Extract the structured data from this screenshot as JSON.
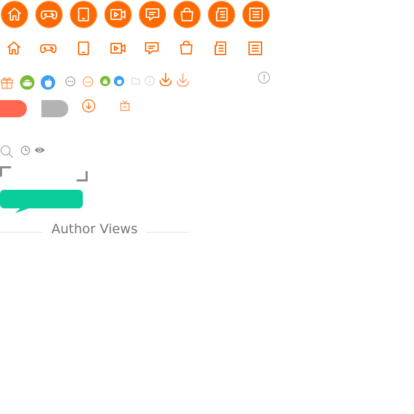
{
  "colors": {
    "primary_orange": "#ff6a00",
    "pill_red": "#ff6753",
    "pill_gray": "#b3b3b3",
    "bubble_teal": "#0acd9c",
    "android_green": "#7cbb38",
    "apple_blue": "#3e9ff0",
    "icon_gray": "#9e9e9e",
    "title_gray": "#757575"
  },
  "icon_row_filled": [
    "home-icon",
    "gamepad-icon",
    "tablet-icon",
    "video-icon",
    "comment-icon",
    "shopping-bag-icon",
    "news-icon",
    "article-icon"
  ],
  "icon_row_outline": [
    "home-icon",
    "gamepad-icon",
    "tablet-icon",
    "video-icon",
    "comment-icon",
    "shopping-bag-icon",
    "news-icon",
    "article-icon"
  ],
  "section": {
    "title": "Author Views"
  }
}
